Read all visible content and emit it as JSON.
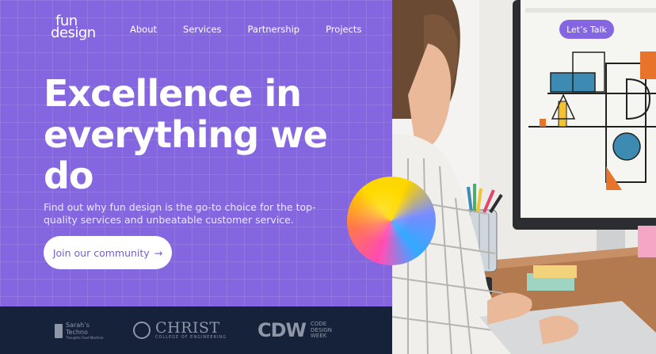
{
  "brand": {
    "line1": "fun",
    "line2": "design"
  },
  "nav": {
    "items": [
      "About",
      "Services",
      "Partnership",
      "Projects"
    ]
  },
  "cta_top": {
    "label": "Let’s Talk"
  },
  "hero": {
    "headline_line1": "Excellence in",
    "headline_line2": "everything we",
    "headline_line3": "do",
    "subtext": "Find out why fun design is the go-to choice for the top-quality services and unbeatable customer service.",
    "button_label": "Join our community",
    "button_arrow": "→"
  },
  "partners": {
    "sarah": {
      "line1": "Sarah’s",
      "line2": "Techno",
      "tagline": "Thoughts Feed Machine"
    },
    "christ": {
      "name": "CHRIST",
      "sub": "COLLEGE OF ENGINEERING"
    },
    "cdw": {
      "mark": "CDW",
      "line1": "CODE",
      "line2": "DESIGN",
      "line3": "WEEK"
    }
  },
  "colors": {
    "accent": "#8467e0",
    "footer": "#16213a",
    "text_light": "#ffffff"
  },
  "icons": [
    "arrow-right-icon",
    "college-seal-icon",
    "sarahs-techno-mark-icon"
  ]
}
